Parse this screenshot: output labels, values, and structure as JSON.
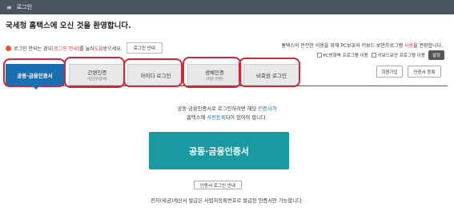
{
  "topbar": {
    "menu_icon": "menu-icon",
    "title": "로그인"
  },
  "welcome": "국세청 홈택스에 오신 것을 환영합니다.",
  "notice": {
    "pre": "로그인 안되는 경우 ",
    "link": "[로그인 안내]",
    "mid": "를 눌러 ",
    "help": "도움",
    "post": "받으세요.",
    "button": "로그인 안내"
  },
  "security": {
    "pre": "홈택스의 안전한 이용을 위해 PC보호와 키보드 보안프로그램 ",
    "red": "사용",
    "post": "을 권장합니다.",
    "firewall": "PC방화벽 프로그램 이용",
    "keyboard": "키보드보안 프로그램 이용",
    "setting": "설정"
  },
  "tabs": [
    {
      "label": "공동·금융인증서",
      "sub": ""
    },
    {
      "label": "간편인증",
      "sub": "(민간인증서)"
    },
    {
      "label": "아이디 로그인",
      "sub": ""
    },
    {
      "label": "생체인증",
      "sub": "(지문·안면)"
    },
    {
      "label": "비회원 로그인",
      "sub": ""
    }
  ],
  "right_buttons": {
    "join": "회원가입",
    "cert_register": "인증서 등록"
  },
  "desc": {
    "line1_pre": "공동·금융인증서로 로그인하려면 해당 ",
    "line1_blue": "인증서",
    "line1_post": "가",
    "line2_pre": "홈택스에 ",
    "line2_blue": "사전등록",
    "line2_post": "되어 있어야 합니다."
  },
  "main_button": "공동·금융인증서",
  "cert_guide": "인증서 로그인 안내",
  "footer": "전자(세금)계산서 발급은 사업자등록번호로 발급된 인증서만 가능합니다.",
  "colors": {
    "active_tab": "#1a6fb3",
    "main_button": "#1a9aa0",
    "highlight": "#d0283a",
    "topbar": "#4b5560"
  }
}
